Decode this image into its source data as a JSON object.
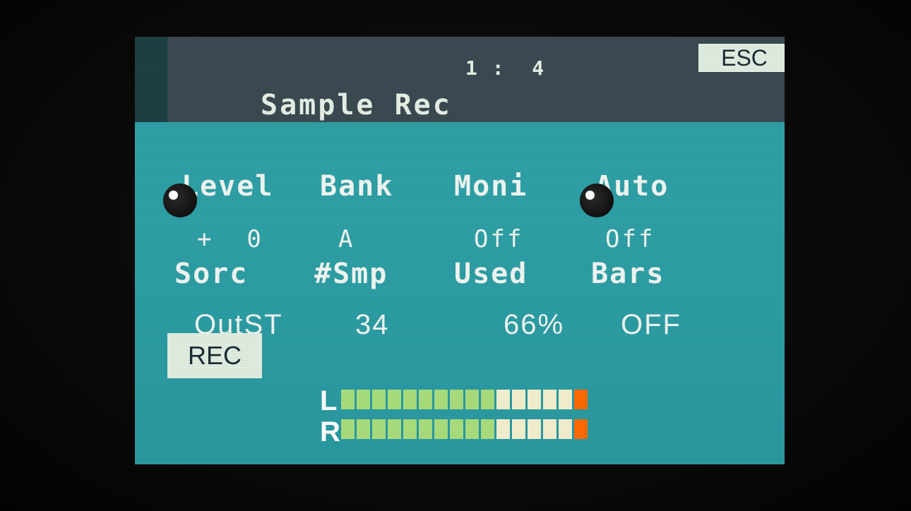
{
  "header": {
    "position": "1 :  4",
    "title": "Sample Rec",
    "esc_label": "ESC"
  },
  "params": [
    {
      "label": "Level",
      "value": "+  0"
    },
    {
      "label": "Bank",
      "value": "A"
    },
    {
      "label": "Moni",
      "value": "Off"
    },
    {
      "label": "Auto",
      "value": "Off"
    },
    {
      "label": "Sorc",
      "value": "OutST"
    },
    {
      "label": "#Smp",
      "value": "34"
    },
    {
      "label": "Used",
      "value": "66%"
    },
    {
      "label": "Bars",
      "value": "OFF"
    }
  ],
  "rec_label": "REC",
  "meters": {
    "left_label": "L",
    "right_label": "R",
    "segments": 16,
    "left_level": 16,
    "right_level": 16,
    "colors": {
      "green": "#a9dd7c",
      "cream": "#f2f0cf",
      "peak": "#ff6a00"
    }
  },
  "colors": {
    "screen": "#2ea0a6",
    "header": "#3a4a50",
    "text": "#f0f6f2"
  }
}
